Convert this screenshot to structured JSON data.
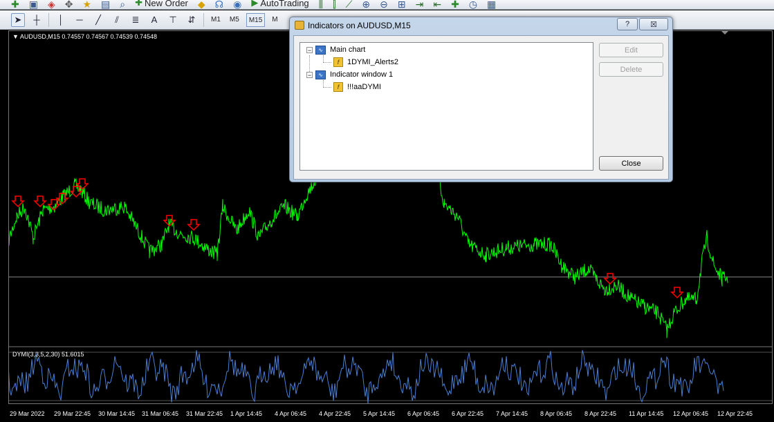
{
  "toolbar_top": {
    "new_order_label": "New Order",
    "autotrading_label": "AutoTrading"
  },
  "toolbar_tools": {
    "timeframes": [
      "M1",
      "M5",
      "M15",
      "M"
    ],
    "active_timeframe": "M15",
    "text_tool_label": "A"
  },
  "chart": {
    "symbol_line": "AUDUSD,M15  0.74557 0.74567 0.74539 0.74548",
    "indicator_label": "DYMI(3,3,5,2,30) 51.6015",
    "price_color": "#00ff00",
    "indicator_color": "#4a7fd4",
    "arrow_color": "#ff0000",
    "time_ticks": [
      "29 Mar 2022",
      "29 Mar 22:45",
      "30 Mar 14:45",
      "31 Mar 06:45",
      "31 Mar 22:45",
      "1 Apr 14:45",
      "4 Apr 06:45",
      "4 Apr 22:45",
      "5 Apr 14:45",
      "6 Apr 06:45",
      "6 Apr 22:45",
      "7 Apr 14:45",
      "8 Apr 06:45",
      "8 Apr 22:45",
      "11 Apr 14:45",
      "12 Apr 06:45",
      "12 Apr 22:45"
    ]
  },
  "dialog": {
    "title": "Indicators on AUDUSD,M15",
    "help_label": "?",
    "close_x_label": "☒",
    "tree": {
      "main_chart_label": "Main chart",
      "main_chart_indicator": "1DYMI_Alerts2",
      "window1_label": "Indicator window 1",
      "window1_indicator": "!!!aaDYMI"
    },
    "buttons": {
      "edit": "Edit",
      "delete": "Delete",
      "close": "Close"
    }
  }
}
